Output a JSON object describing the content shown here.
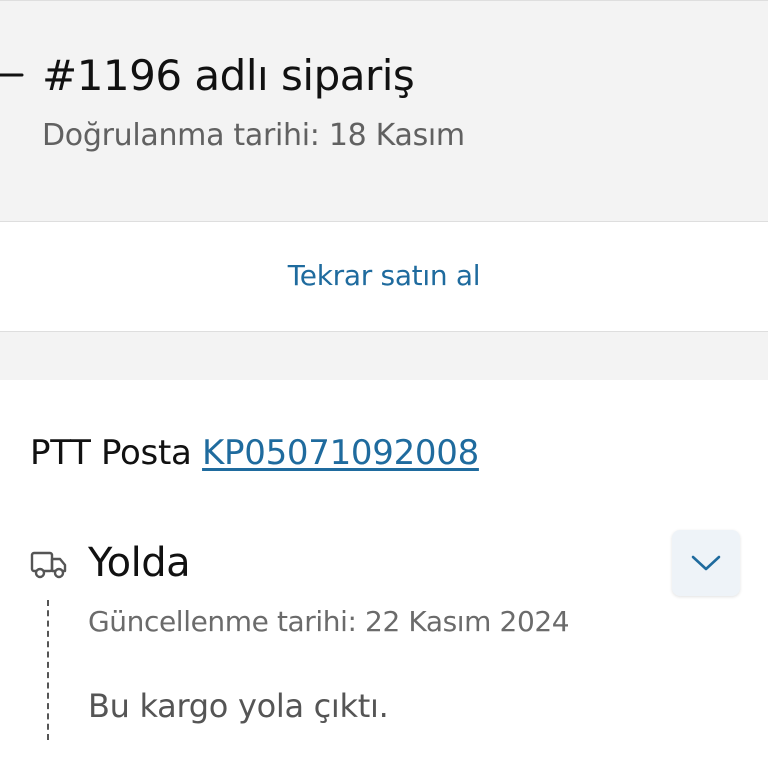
{
  "header": {
    "title": "#1196 adlı sipariş",
    "subtitle": "Doğrulanma tarihi: 18 Kasım"
  },
  "rebuy": {
    "label": "Tekrar satın al"
  },
  "shipment": {
    "carrier": "PTT Posta",
    "tracking_number": "KP05071092008",
    "status": "Yolda",
    "updated": "Güncellenme tarihi: 22 Kasım 2024",
    "message": "Bu kargo yola çıktı."
  },
  "icons": {
    "back": "arrow-left-icon",
    "truck": "truck-icon",
    "expand": "chevron-down-icon"
  },
  "colors": {
    "link": "#1f6b9e",
    "header_bg": "#f3f3f3",
    "expand_bg": "#eef3f8"
  }
}
